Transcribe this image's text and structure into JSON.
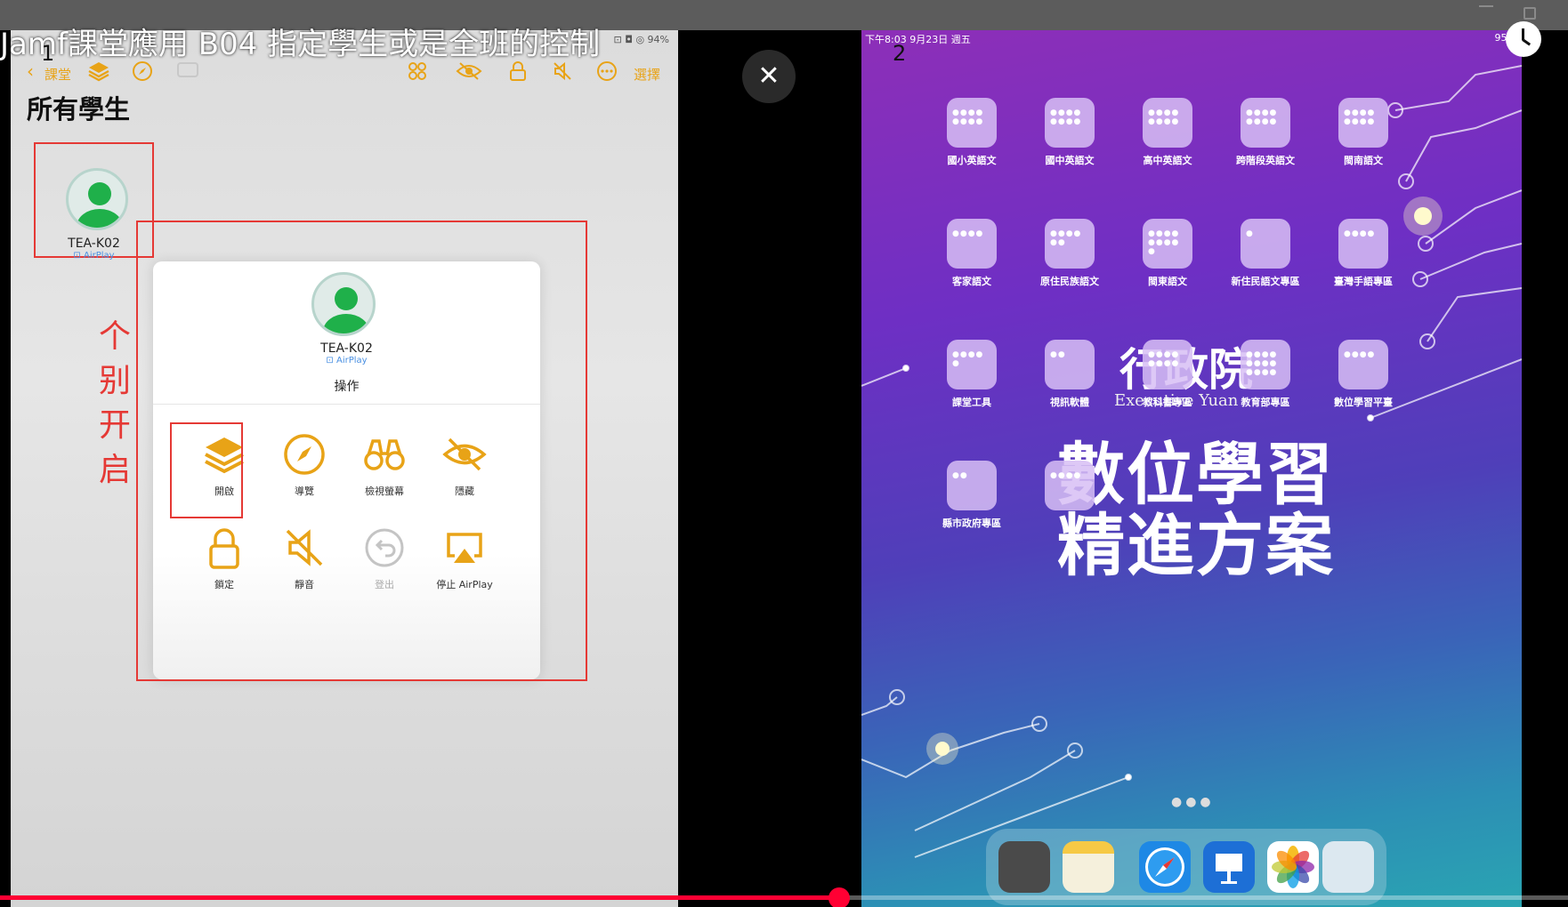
{
  "video": {
    "title": "Jamf課堂應用 B04 指定學生或是全班的控制",
    "progress_fraction": 0.535
  },
  "panel_numbers": {
    "left": "1",
    "right": "2"
  },
  "teacher_ipad": {
    "status_right": "⊡ ◘ ◎ 94%",
    "toolbar": {
      "back_label": "課堂",
      "select_label": "選擇"
    },
    "heading": "所有學生",
    "student": {
      "name": "TEA-K02",
      "airplay": "AirPlay"
    },
    "annotation": [
      "个",
      "别",
      "开",
      "启"
    ],
    "popover": {
      "name": "TEA-K02",
      "airplay": "AirPlay",
      "title": "操作",
      "actions": [
        {
          "icon": "layers-icon",
          "label": "開啟"
        },
        {
          "icon": "compass-icon",
          "label": "導覽"
        },
        {
          "icon": "binoculars-icon",
          "label": "檢視螢幕"
        },
        {
          "icon": "eye-slash-icon",
          "label": "隱藏"
        },
        {
          "icon": "lock-icon",
          "label": "鎖定"
        },
        {
          "icon": "mute-icon",
          "label": "靜音"
        },
        {
          "icon": "logout-icon",
          "label": "登出"
        },
        {
          "icon": "airplay-icon",
          "label": "停止 AirPlay"
        }
      ]
    }
  },
  "student_ipad": {
    "status_left": "下午8:03  9月23日 週五",
    "status_right": "95%",
    "apps": [
      "國小英語文",
      "國中英語文",
      "高中英語文",
      "跨階段英語文",
      "閩南語文",
      "客家語文",
      "原住民族語文",
      "閩東語文",
      "新住民語文專區",
      "臺灣手語專區",
      "課堂工具",
      "視訊軟體",
      "教科書專區",
      "教育部專區",
      "數位學習平臺",
      "縣市政府專區"
    ],
    "background": {
      "ey_text": "行政院",
      "exec_text": "Executive Yuan",
      "title_line1": "數位學習",
      "title_line2": "精進方案"
    },
    "page_dots": "●●●",
    "dock": [
      {
        "icon": "edu-icon",
        "color": "#4a4a4a"
      },
      {
        "icon": "notes-icon",
        "color": "#f5f0dc"
      },
      {
        "icon": "safari-icon",
        "color": "#1e88e5"
      },
      {
        "icon": "keynote-icon",
        "color": "#1d6fd6"
      },
      {
        "icon": "photos-icon",
        "color": "#ffffff"
      },
      {
        "icon": "app-library-icon",
        "color": "#dce8f0"
      }
    ]
  },
  "colors": {
    "accent": "#e8a317",
    "annotation": "#e53935",
    "progress": "#ff0033"
  }
}
